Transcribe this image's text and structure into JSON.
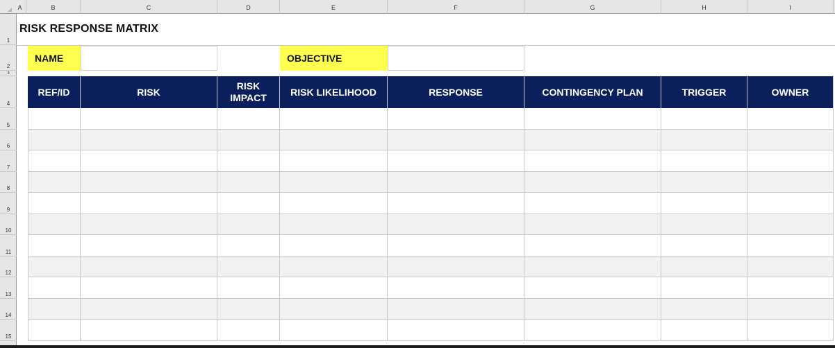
{
  "column_headers": [
    "A",
    "B",
    "C",
    "D",
    "E",
    "F",
    "G",
    "H",
    "I"
  ],
  "row_headers": [
    "1",
    "2",
    "3",
    "4",
    "5",
    "6",
    "7",
    "8",
    "9",
    "10",
    "11",
    "12",
    "13",
    "14",
    "15"
  ],
  "sheet": {
    "title": "RISK RESPONSE MATRIX",
    "name_label": "NAME",
    "name_value": "",
    "objective_label": "OBJECTIVE",
    "objective_value": ""
  },
  "table": {
    "headers": [
      "REF/ID",
      "RISK",
      "RISK IMPACT",
      "RISK LIKELIHOOD",
      "RESPONSE",
      "CONTINGENCY PLAN",
      "TRIGGER",
      "OWNER"
    ],
    "row_count": 11
  },
  "colors": {
    "header_bg": "#0b1f5c",
    "label_bg": "#ffff4f",
    "alt_row_bg": "#f1f1f1"
  }
}
